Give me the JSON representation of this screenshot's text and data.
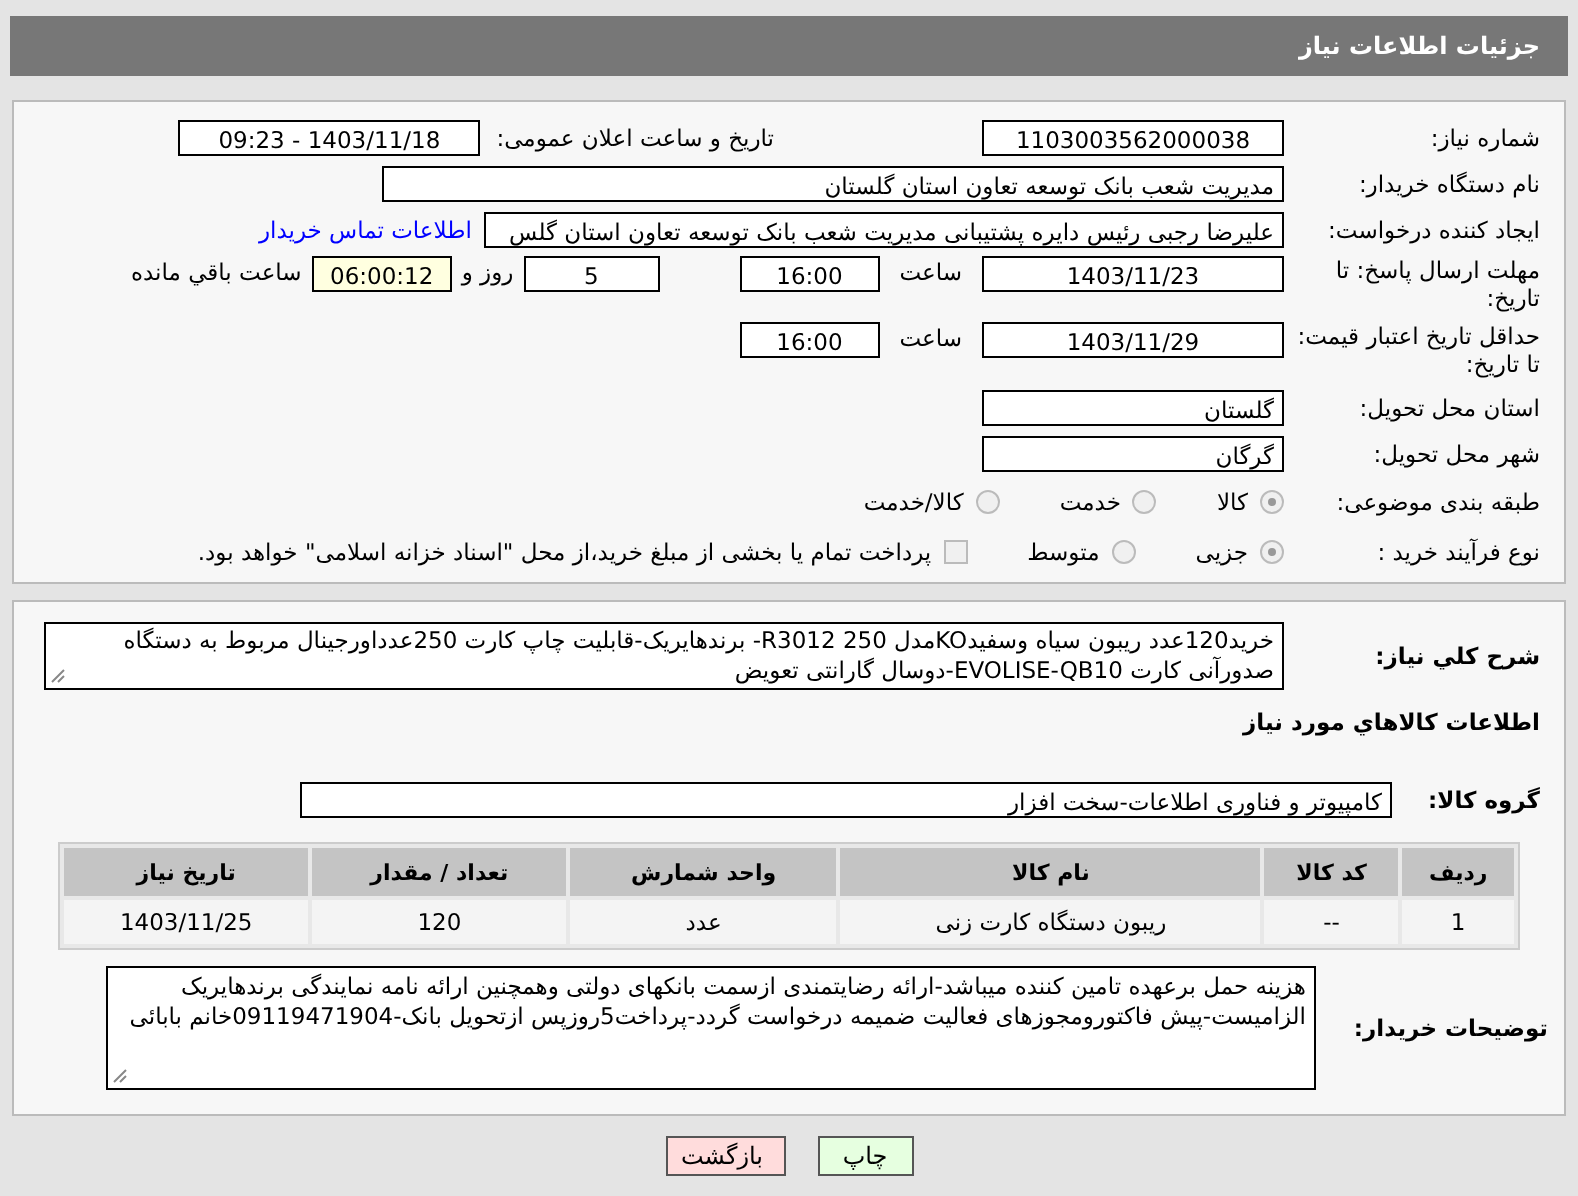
{
  "page_title": "جزئیات اطلاعات نیاز",
  "need_number": {
    "label": "شماره نیاز:",
    "value": "1103003562000038"
  },
  "announce": {
    "label": "تاریخ و ساعت اعلان عمومی:",
    "value": "1403/11/18 - 09:23"
  },
  "buyer_org": {
    "label": "نام دستگاه خریدار:",
    "value": "مدیریت شعب بانک توسعه تعاون استان گلستان"
  },
  "requester": {
    "label": "ایجاد کننده درخواست:",
    "value": "علیرضا رجبی رئیس دایره پشتیبانی مدیریت شعب بانک توسعه تعاون استان گلس",
    "link": "اطلاعات تماس خریدار"
  },
  "deadline": {
    "label": "مهلت ارسال پاسخ: تا تاریخ:",
    "date": "1403/11/23",
    "time_label": "ساعت",
    "time": "16:00",
    "days": "5",
    "days_label": "روز و",
    "remaining": "06:00:12",
    "remaining_label": "ساعت باقي مانده"
  },
  "validity": {
    "label": "حداقل تاریخ اعتبار قیمت: تا تاریخ:",
    "date": "1403/11/29",
    "time_label": "ساعت",
    "time": "16:00"
  },
  "province": {
    "label": "استان محل تحویل:",
    "value": "گلستان"
  },
  "city": {
    "label": "شهر محل تحویل:",
    "value": "گرگان"
  },
  "category": {
    "label": "طبقه بندی موضوعی:",
    "options": [
      {
        "label": "کالا",
        "selected": true
      },
      {
        "label": "خدمت",
        "selected": false
      },
      {
        "label": "کالا/خدمت",
        "selected": false
      }
    ]
  },
  "process": {
    "label": "نوع فرآیند خرید :",
    "options": [
      {
        "label": "جزیی",
        "selected": true
      },
      {
        "label": "متوسط",
        "selected": false
      }
    ],
    "treasury": {
      "label": "پرداخت تمام یا بخشی از مبلغ خرید،از محل \"اسناد خزانه اسلامی\" خواهد بود.",
      "checked": false
    }
  },
  "description": {
    "label": "شرح کلي نیاز:",
    "value": "خرید120عدد  ریبون  سیاه وسفیدKOمدل 250  R3012- برندهایریک-قابلیت چاپ کارت 250عدداورجینال مربوط به دستگاه صدورآنی کارت EVOLISE-QB10-دوسال گارانتی تعویض"
  },
  "goods_heading": "اطلاعات کالاهاي مورد نیاز",
  "goods_group": {
    "label": "گروه کالا:",
    "value": "کامپیوتر و فناوری اطلاعات-سخت افزار"
  },
  "table": {
    "columns": [
      "ردیف",
      "کد کالا",
      "نام کالا",
      "واحد شمارش",
      "تعداد / مقدار",
      "تاریخ نیاز"
    ],
    "rows": [
      [
        "1",
        "--",
        "ریبون دستگاه کارت زنی",
        "عدد",
        "120",
        "1403/11/25"
      ]
    ]
  },
  "buyer_notes": {
    "label": "توضیحات خریدار:",
    "value": "هزینه حمل برعهده تامین کننده میباشد-ارائه رضایتمندی ازسمت بانکهای دولتی وهمچنین ارائه نامه نمایندگی برندهایریک الزامیست-پیش فاکتورومجوزهای فعالیت ضمیمه درخواست گردد-پرداخت5روزپس ازتحویل بانک-09119471904خانم بابائی"
  },
  "buttons": [
    {
      "label": "چاپ",
      "kind": "print"
    },
    {
      "label": "بازگشت",
      "kind": "back"
    }
  ]
}
